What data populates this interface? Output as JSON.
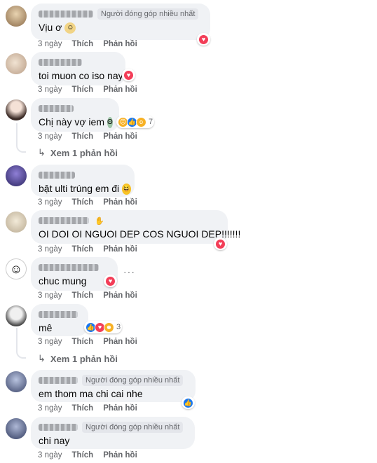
{
  "colors": {
    "bubble": "#f0f2f5",
    "meta": "#65676b",
    "text": "#050505",
    "heart": "#f33e58",
    "like": "#1877f2"
  },
  "labels": {
    "like": "Thích",
    "reply": "Phản hồi",
    "top_fan": "Người đóng góp nhiều nhất"
  },
  "comments": [
    {
      "text": "Vịu ơ",
      "time": "3 ngày",
      "badge": "Người đóng góp nhiều nhất",
      "emoji": "smile-icon",
      "reaction": "heart"
    },
    {
      "text": "toi muon co iso nay",
      "time": "3 ngày",
      "reaction": "heart"
    },
    {
      "text": "Chị này vợ iem",
      "time": "3 ngày",
      "emoji": "grin-icon",
      "reactions_count": "7",
      "view_replies": "Xem 1 phản hồi"
    },
    {
      "text": "bật ulti trúng em đi",
      "time": "3 ngày",
      "emoji": "laugh-icon"
    },
    {
      "text": "OI DOI OI NGUOI DEP COS NGUOI DEP!!!!!!!",
      "time": "3 ngày",
      "reaction": "heart"
    },
    {
      "text": "chuc mung",
      "time": "3 ngày",
      "reaction": "heart"
    },
    {
      "text": "mê",
      "time": "3 ngày",
      "reactions_count": "3",
      "view_replies": "Xem 1 phản hồi"
    },
    {
      "text": "em thom ma chi cai nhe",
      "time": "3 ngày",
      "badge": "Người đóng góp nhiều nhất",
      "reaction": "like"
    },
    {
      "text": "chi nay",
      "time": "3 ngày",
      "badge": "Người đóng góp nhiều nhất"
    }
  ]
}
